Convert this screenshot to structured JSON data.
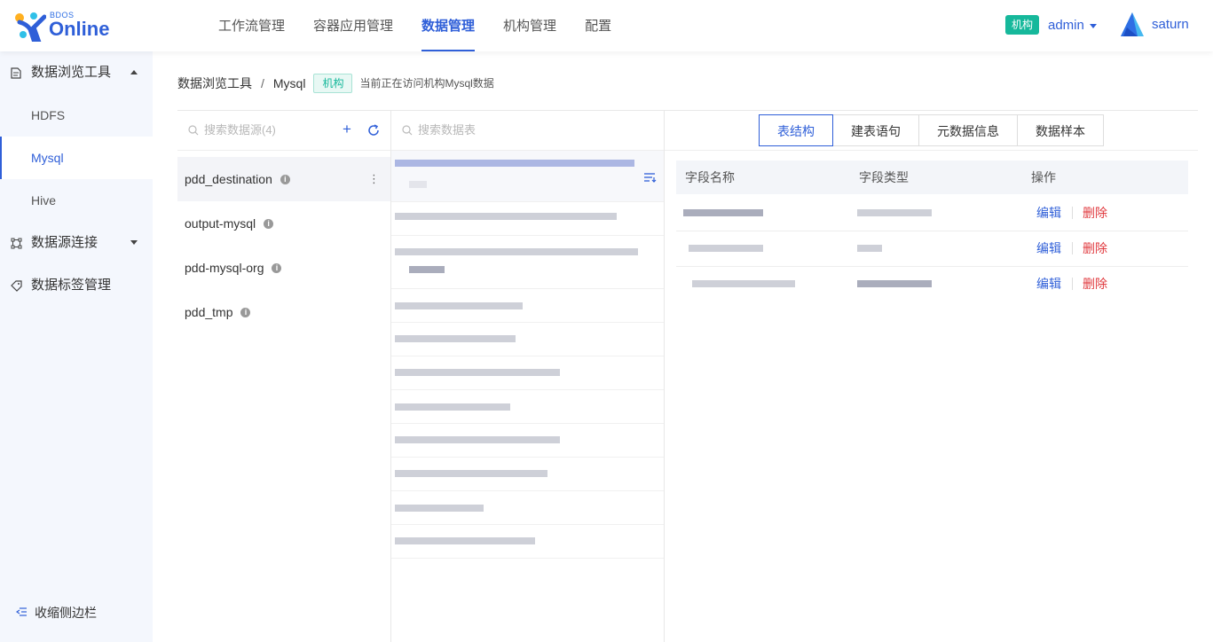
{
  "brand": {
    "small": "BDOS",
    "big": "Online"
  },
  "nav": [
    {
      "label": "工作流管理",
      "active": false
    },
    {
      "label": "容器应用管理",
      "active": false
    },
    {
      "label": "数据管理",
      "active": true
    },
    {
      "label": "机构管理",
      "active": false
    },
    {
      "label": "配置",
      "active": false
    }
  ],
  "header": {
    "org_badge": "机构",
    "user": "admin",
    "workspace": "saturn"
  },
  "sidebar": {
    "groups": [
      {
        "label": "数据浏览工具",
        "icon": "document-icon",
        "expanded": true,
        "items": [
          {
            "label": "HDFS"
          },
          {
            "label": "Mysql"
          },
          {
            "label": "Hive"
          }
        ]
      },
      {
        "label": "数据源连接",
        "icon": "connection-icon",
        "expanded": false
      },
      {
        "label": "数据标签管理",
        "icon": "tag-icon"
      }
    ],
    "selected": "Mysql",
    "collapse_label": "收缩侧边栏"
  },
  "breadcrumb": {
    "root": "数据浏览工具",
    "sep": "/",
    "current": "Mysql",
    "tag": "机构",
    "note": "当前正在访问机构Mysql数据"
  },
  "datasources": {
    "search_placeholder": "搜索数据源(4)",
    "add_label": "+",
    "items": [
      {
        "name": "pdd_destination",
        "selected": true
      },
      {
        "name": "output-mysql",
        "selected": false
      },
      {
        "name": "pdd-mysql-org",
        "selected": false
      },
      {
        "name": "pdd_tmp",
        "selected": false
      }
    ]
  },
  "tables": {
    "search_placeholder": "搜索数据表"
  },
  "detail": {
    "tabs": [
      {
        "label": "表结构",
        "active": true
      },
      {
        "label": "建表语句",
        "active": false
      },
      {
        "label": "元数据信息",
        "active": false
      },
      {
        "label": "数据样本",
        "active": false
      }
    ],
    "columns": {
      "name": "字段名称",
      "type": "字段类型",
      "action": "操作"
    },
    "actions": {
      "edit": "编辑",
      "delete": "删除"
    },
    "row_count": 3
  },
  "colors": {
    "primary": "#2f5fd8",
    "teal": "#16b89b",
    "danger": "#e0393e",
    "sidebar_bg": "#f4f7fd"
  }
}
